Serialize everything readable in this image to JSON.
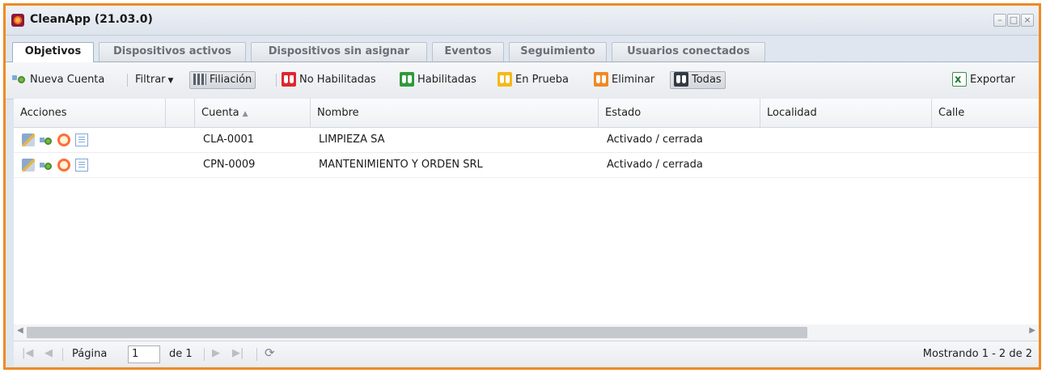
{
  "window": {
    "title": "CleanApp (21.03.0)",
    "controls": [
      "minimize-icon",
      "maximize-icon",
      "close-icon"
    ],
    "accent_color": "#f08a24"
  },
  "tabs": [
    {
      "label": "Objetivos",
      "active": true
    },
    {
      "label": "Dispositivos activos",
      "active": false
    },
    {
      "label": "Dispositivos sin asignar",
      "active": false
    },
    {
      "label": "Eventos",
      "active": false
    },
    {
      "label": "Seguimiento",
      "active": false
    },
    {
      "label": "Usuarios conectados",
      "active": false
    }
  ],
  "toolbar": {
    "new_account": "Nueva Cuenta",
    "filter": "Filtrar",
    "filiation": "Filiación",
    "not_enabled": "No Habilitadas",
    "enabled": "Habilitadas",
    "testing": "En Prueba",
    "delete": "Eliminar",
    "all": "Todas",
    "export": "Exportar",
    "colors": {
      "not_enabled": "#e0262e",
      "enabled": "#2f9a3a",
      "testing": "#f6b81a",
      "delete": "#f08a24",
      "all": "#333a42"
    }
  },
  "grid": {
    "columns": [
      "Acciones",
      "",
      "Cuenta",
      "Nombre",
      "Estado",
      "Localidad",
      "Calle"
    ],
    "sorted_column": "Cuenta",
    "sort_direction": "asc",
    "rows": [
      {
        "actions": [
          "edit-icon",
          "user-add-icon",
          "alarm-clock-icon",
          "list-icon"
        ],
        "cuenta": "CLA-0001",
        "nombre": "LIMPIEZA SA",
        "estado": "Activado / cerrada",
        "localidad": "",
        "calle": ""
      },
      {
        "actions": [
          "edit-icon",
          "user-add-icon",
          "alarm-clock-icon",
          "list-icon"
        ],
        "cuenta": "CPN-0009",
        "nombre": "MANTENIMIENTO Y ORDEN SRL",
        "estado": "Activado / cerrada",
        "localidad": "",
        "calle": ""
      }
    ]
  },
  "pager": {
    "page_label": "Página",
    "page_value": "1",
    "of_label": "de 1",
    "summary": "Mostrando 1 - 2 de 2"
  }
}
